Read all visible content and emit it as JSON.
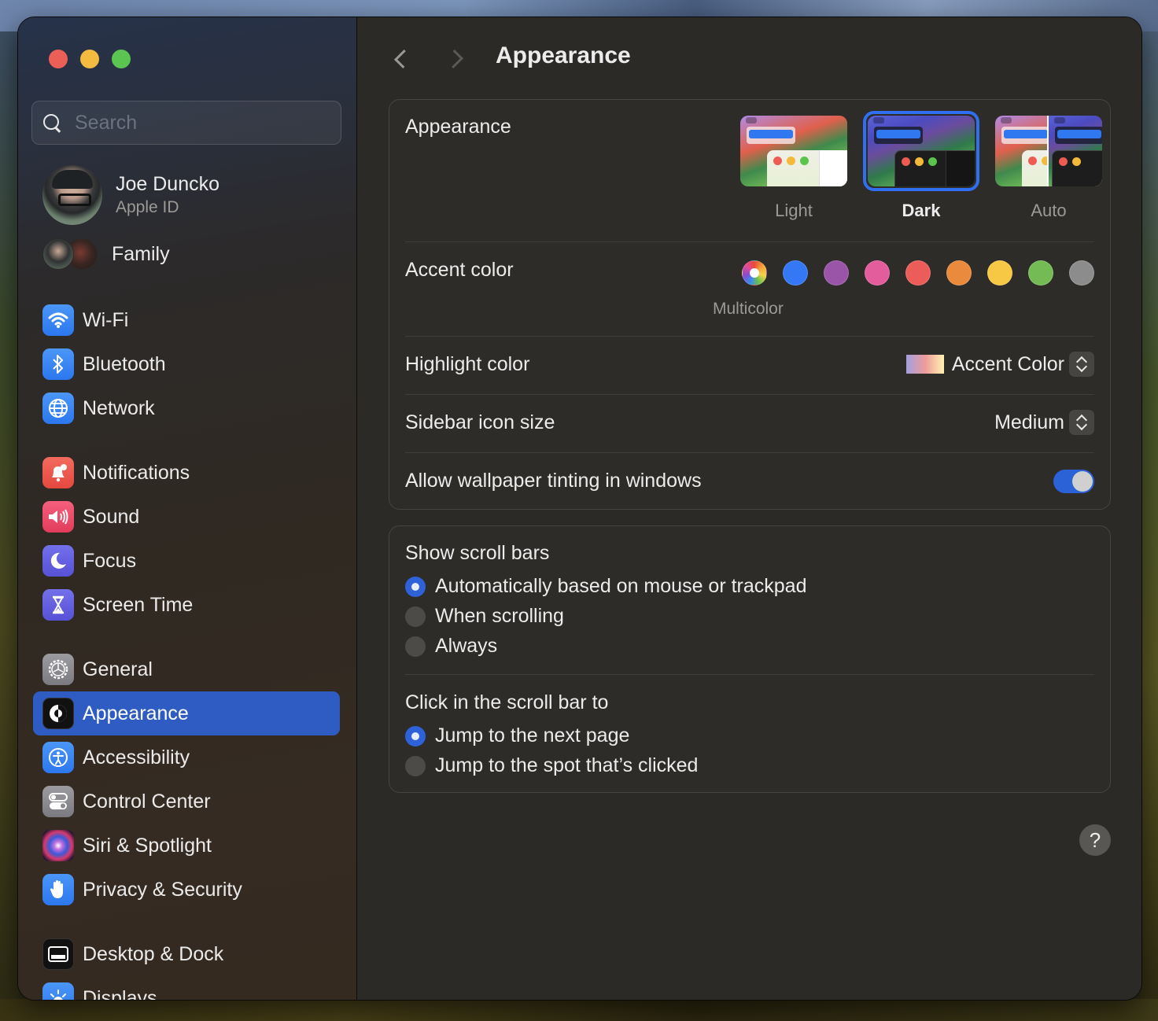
{
  "window": {
    "traffic_lights": [
      "close",
      "minimize",
      "zoom"
    ]
  },
  "sidebar": {
    "search": {
      "placeholder": "Search",
      "value": ""
    },
    "profile": {
      "name": "Joe Duncko",
      "subtitle": "Apple ID"
    },
    "family": {
      "label": "Family"
    },
    "items": [
      {
        "label": "Wi-Fi",
        "icon": "wifi-icon",
        "color": "#3a86f3"
      },
      {
        "label": "Bluetooth",
        "icon": "bluetooth-icon",
        "color": "#3a86f3"
      },
      {
        "label": "Network",
        "icon": "globe-icon",
        "color": "#3a86f3"
      },
      {
        "label": "Notifications",
        "icon": "bell-icon",
        "color": "#ec5a4e"
      },
      {
        "label": "Sound",
        "icon": "speaker-icon",
        "color": "#ec4d6c"
      },
      {
        "label": "Focus",
        "icon": "moon-icon",
        "color": "#6660e0"
      },
      {
        "label": "Screen Time",
        "icon": "hourglass-icon",
        "color": "#6660e0"
      },
      {
        "label": "General",
        "icon": "gear-icon",
        "color": "#8a8a90"
      },
      {
        "label": "Appearance",
        "icon": "appearance-icon",
        "color": "#111111",
        "active": true
      },
      {
        "label": "Accessibility",
        "icon": "accessibility-icon",
        "color": "#3a86f3"
      },
      {
        "label": "Control Center",
        "icon": "toggles-icon",
        "color": "#8a8a90"
      },
      {
        "label": "Siri & Spotlight",
        "icon": "siri-icon",
        "color": "#7a3ab0"
      },
      {
        "label": "Privacy & Security",
        "icon": "hand-icon",
        "color": "#3a86f3"
      },
      {
        "label": "Desktop & Dock",
        "icon": "dock-icon",
        "color": "#111111"
      },
      {
        "label": "Displays",
        "icon": "sun-icon",
        "color": "#3a86f3"
      }
    ]
  },
  "header": {
    "title": "Appearance",
    "back_label": "Back",
    "forward_label": "Forward"
  },
  "settings": {
    "appearance": {
      "label": "Appearance",
      "options": [
        {
          "label": "Light",
          "selected": false
        },
        {
          "label": "Dark",
          "selected": true
        },
        {
          "label": "Auto",
          "selected": false
        }
      ]
    },
    "accent": {
      "label": "Accent color",
      "selected_caption": "Multicolor",
      "colors": [
        {
          "name": "Multicolor",
          "hex": "multicolor"
        },
        {
          "name": "Blue",
          "hex": "#3478f6"
        },
        {
          "name": "Purple",
          "hex": "#9b55a8"
        },
        {
          "name": "Pink",
          "hex": "#e35d9c"
        },
        {
          "name": "Red",
          "hex": "#ec5d5a"
        },
        {
          "name": "Orange",
          "hex": "#e98a3c"
        },
        {
          "name": "Yellow",
          "hex": "#f7c844"
        },
        {
          "name": "Green",
          "hex": "#75bb55"
        },
        {
          "name": "Graphite",
          "hex": "#8c8c8c"
        }
      ]
    },
    "highlight": {
      "label": "Highlight color",
      "value": "Accent Color"
    },
    "sidebar_icon_size": {
      "label": "Sidebar icon size",
      "value": "Medium"
    },
    "wallpaper_tinting": {
      "label": "Allow wallpaper tinting in windows",
      "on": true
    }
  },
  "scroll_bars": {
    "show_title": "Show scroll bars",
    "show_options": [
      {
        "label": "Automatically based on mouse or trackpad",
        "selected": true
      },
      {
        "label": "When scrolling",
        "selected": false
      },
      {
        "label": "Always",
        "selected": false
      }
    ],
    "click_title": "Click in the scroll bar to",
    "click_options": [
      {
        "label": "Jump to the next page",
        "selected": true
      },
      {
        "label": "Jump to the spot that’s clicked",
        "selected": false
      }
    ]
  },
  "help": {
    "label": "?"
  }
}
